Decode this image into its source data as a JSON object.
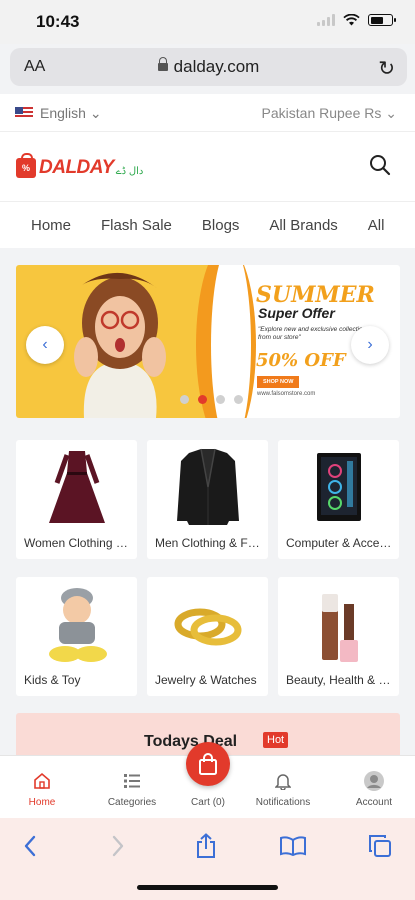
{
  "status": {
    "time": "10:43"
  },
  "browser": {
    "text_size_label": "AA",
    "url": "dalday.com"
  },
  "locale": {
    "language": "English",
    "currency": "Pakistan Rupee Rs"
  },
  "brand": {
    "name": "DALDAY",
    "tagline": "دال ڈے",
    "bag_mark": "%"
  },
  "nav": [
    "Home",
    "Flash Sale",
    "Blogs",
    "All Brands",
    "All"
  ],
  "banner": {
    "headline": "SUMMER",
    "subhead": "Super Offer",
    "body": "\"Explore new and exclusive collection from our store\"",
    "discount": "50% OFF",
    "cta": "SHOP NOW",
    "site": "www.falsomstore.com",
    "slide_count": 4,
    "active_slide": 2
  },
  "categories": [
    {
      "label": "Women Clothing & Fashion",
      "icon": "dress-icon"
    },
    {
      "label": "Men Clothing & Fashion",
      "icon": "blazer-icon"
    },
    {
      "label": "Computer & Accessories",
      "icon": "pc-case-icon"
    },
    {
      "label": "Kids & Toy",
      "icon": "baby-icon"
    },
    {
      "label": "Jewelry & Watches",
      "icon": "rings-icon"
    },
    {
      "label": "Beauty, Health & Hair",
      "icon": "cosmetics-icon"
    }
  ],
  "deal": {
    "title": "Todays Deal",
    "badge": "Hot"
  },
  "bottom_nav": {
    "home": "Home",
    "categories": "Categories",
    "cart": "Cart (0)",
    "notifications": "Notifications",
    "account": "Account"
  },
  "colors": {
    "brand_red": "#e23a2b",
    "banner_yellow": "#f7c63e",
    "banner_orange": "#f2a01c",
    "link_blue": "#3c6fd6"
  }
}
